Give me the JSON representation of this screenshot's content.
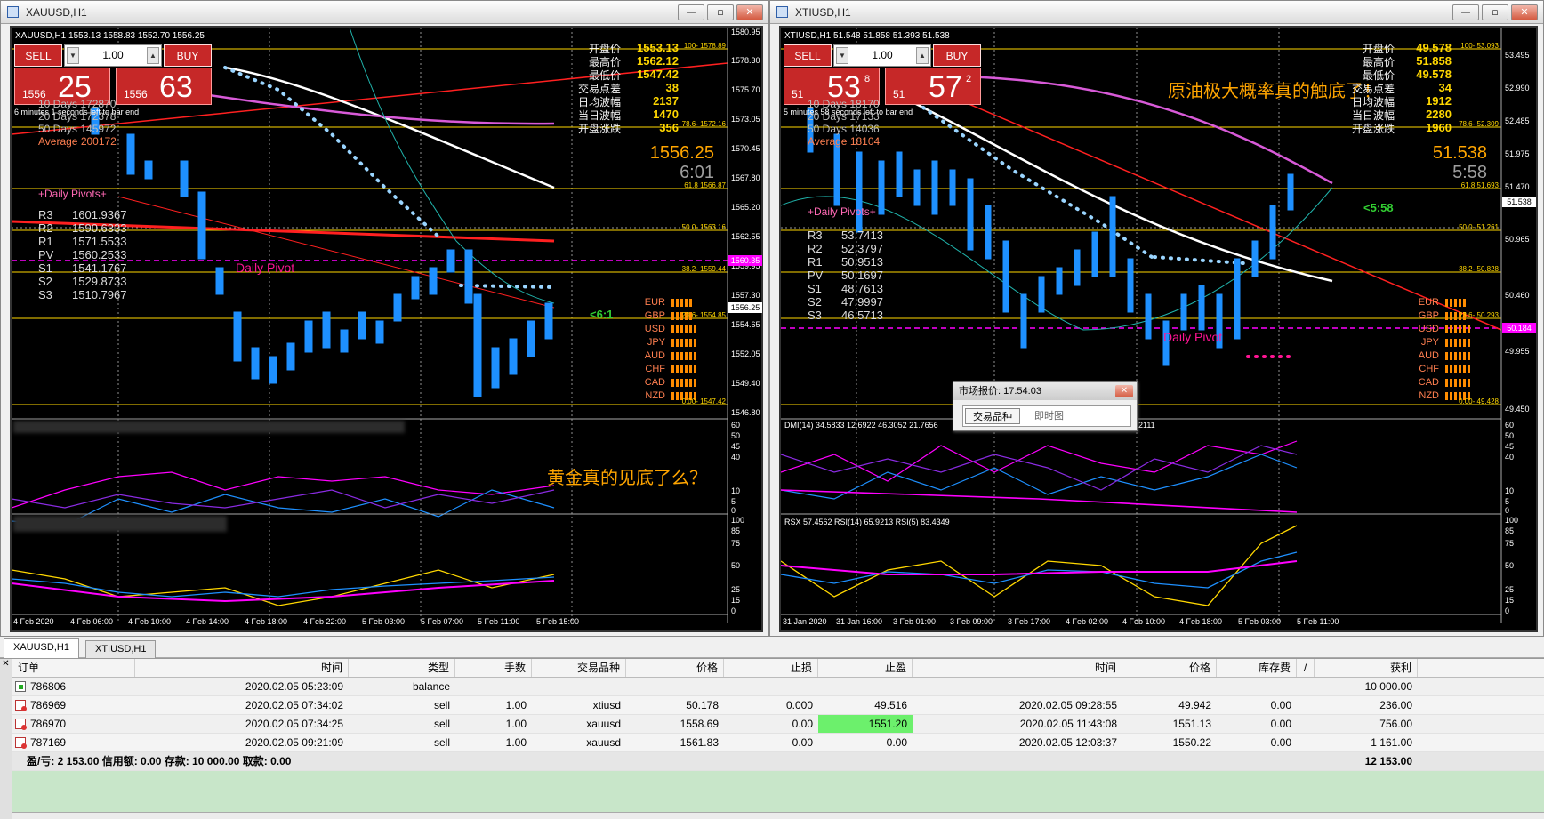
{
  "left_window": {
    "title": "XAUUSD,H1",
    "symbol_line": "XAUUSD,H1  1553.13 1558.83 1552.70 1556.25",
    "trade_panel": {
      "sell": "SELL",
      "buy": "BUY",
      "lot": "1.00",
      "bid_small": "1556",
      "bid_big": "25",
      "bid_sup": "",
      "ask_small": "1556",
      "ask_big": "63",
      "ask_sup": ""
    },
    "time_left": "6 minutes 1 seconds left to bar end",
    "ma_rows": [
      "10 Days  172870",
      "20 Days  172378",
      "50 Days  145972",
      "Average  200172"
    ],
    "pivots_title": "+Daily Pivots+",
    "pivots": [
      {
        "label": "R3",
        "value": "1601.9367"
      },
      {
        "label": "R2",
        "value": "1590.6333"
      },
      {
        "label": "R1",
        "value": "1571.5533"
      },
      {
        "label": "PV",
        "value": "1560.2533"
      },
      {
        "label": "S1",
        "value": "1541.1767"
      },
      {
        "label": "S2",
        "value": "1529.8733"
      },
      {
        "label": "S3",
        "value": "1510.7967"
      }
    ],
    "daily_pivot_label": "Daily Pivot",
    "info": [
      {
        "label": "开盘价",
        "value": "1553.13"
      },
      {
        "label": "最高价",
        "value": "1562.12"
      },
      {
        "label": "最低价",
        "value": "1547.42"
      },
      {
        "label": "交易点差",
        "value": "38"
      },
      {
        "label": "日均波幅",
        "value": "2137"
      },
      {
        "label": "当日波幅",
        "value": "1470"
      },
      {
        "label": "开盘涨跌",
        "value": "356"
      }
    ],
    "big_price": "1556.25",
    "big_time": "6:01",
    "ratio": "<6:1",
    "currencies": [
      "EUR",
      "GBP",
      "USD",
      "JPY",
      "AUD",
      "CHF",
      "CAD",
      "NZD"
    ],
    "fib_labels": [
      "100- 1578.89",
      "78.6- 1572.16",
      "61.8 1566.87",
      "50.0- 1563.16",
      "38.2- 1559.44",
      "23.6- 1554.85",
      "0.00- 1547.42"
    ],
    "price_axis": [
      "1580.95",
      "1578.30",
      "1575.70",
      "1573.05",
      "1570.45",
      "1567.80",
      "1565.20",
      "1562.55",
      "1559.95",
      "1557.30",
      "1554.65",
      "1552.05",
      "1549.40",
      "1546.80"
    ],
    "price_tag_magenta": "1560.35",
    "price_tag_white": "1556.25",
    "annotation": "黄金真的见底了么？",
    "dmi_levels": [
      "60",
      "50",
      "45",
      "40",
      "10",
      "5",
      "0"
    ],
    "rsi_levels": [
      "100",
      "85",
      "75",
      "50",
      "25",
      "15",
      "0"
    ],
    "time_axis": [
      "4 Feb 2020",
      "4 Feb 06:00",
      "4 Feb 10:00",
      "4 Feb 14:00",
      "4 Feb 18:00",
      "4 Feb 22:00",
      "5 Feb 03:00",
      "5 Feb 07:00",
      "5 Feb 11:00",
      "5 Feb 15:00"
    ]
  },
  "right_window": {
    "title": "XTIUSD,H1",
    "symbol_line": "XTIUSD,H1  51.548 51.858 51.393 51.538",
    "trade_panel": {
      "sell": "SELL",
      "buy": "BUY",
      "lot": "1.00",
      "bid_small": "51",
      "bid_big": "53",
      "bid_sup": "8",
      "ask_small": "51",
      "ask_big": "57",
      "ask_sup": "2"
    },
    "time_left": "5 minutes 58 seconds left to bar end",
    "ma_rows": [
      "10 Days  18170",
      "20 Days  17133",
      "50 Days  14036",
      "Average  18104"
    ],
    "pivots_title": "+Daily Pivots+",
    "pivots": [
      {
        "label": "R3",
        "value": "53.7413"
      },
      {
        "label": "R2",
        "value": "52.3797"
      },
      {
        "label": "R1",
        "value": "50.9513"
      },
      {
        "label": "PV",
        "value": "50.1697"
      },
      {
        "label": "S1",
        "value": "48.7613"
      },
      {
        "label": "S2",
        "value": "47.9997"
      },
      {
        "label": "S3",
        "value": "46.5713"
      }
    ],
    "daily_pivot_label": "Daily Pivot",
    "info": [
      {
        "label": "开盘价",
        "value": "49.578"
      },
      {
        "label": "最高价",
        "value": "51.858"
      },
      {
        "label": "最低价",
        "value": "49.578"
      },
      {
        "label": "交易点差",
        "value": "34"
      },
      {
        "label": "日均波幅",
        "value": "1912"
      },
      {
        "label": "当日波幅",
        "value": "2280"
      },
      {
        "label": "开盘涨跌",
        "value": "1960"
      }
    ],
    "big_price": "51.538",
    "big_time": "5:58",
    "ratio": "<5:58",
    "currencies": [
      "EUR",
      "GBP",
      "USD",
      "JPY",
      "AUD",
      "CHF",
      "CAD",
      "NZD"
    ],
    "fib_labels": [
      "100- 53.093",
      "78.6- 52.309",
      "61.8 51.693",
      "50.0- 51.261",
      "38.2- 50.828",
      "23.6- 50.293",
      "0.00- 49.428"
    ],
    "price_axis": [
      "53.495",
      "52.990",
      "52.485",
      "51.975",
      "51.470",
      "50.965",
      "50.460",
      "49.955",
      "49.450"
    ],
    "price_tag_magenta": "50.184",
    "price_tag_white": "51.538",
    "annotation": "原油极大概率真的触底了！",
    "dmi_line": "DMI(14) 34.5833 12.6922 46.3052 21.7656",
    "dmi_tail": "2111",
    "rsi_line": "RSX 57.4562  RSI(14) 65.9213  RSI(5) 83.4349",
    "dmi_levels": [
      "60",
      "50",
      "45",
      "40",
      "10",
      "5",
      "0"
    ],
    "rsi_levels": [
      "100",
      "85",
      "75",
      "50",
      "25",
      "15",
      "0"
    ],
    "time_axis": [
      "31 Jan 2020",
      "31 Jan 16:00",
      "3 Feb 01:00",
      "3 Feb 09:00",
      "3 Feb 17:00",
      "4 Feb 02:00",
      "4 Feb 10:00",
      "4 Feb 18:00",
      "5 Feb 03:00",
      "5 Feb 11:00"
    ]
  },
  "quote_popup": {
    "title": "市场报价: 17:54:03",
    "tab_active": "交易品种",
    "tab_inactive": "即时图"
  },
  "chart_tabs": [
    "XAUUSD,H1",
    "XTIUSD,H1"
  ],
  "terminal": {
    "headers": [
      "订单",
      "时间",
      "类型",
      "手数",
      "交易品种",
      "价格",
      "止损",
      "止盈",
      "时间",
      "价格",
      "库存费",
      "/",
      "获利"
    ],
    "rows": [
      {
        "order": "786806",
        "time": "2020.02.05 05:23:09",
        "type": "balance",
        "lots": "",
        "symbol": "",
        "price": "",
        "sl": "",
        "tp": "",
        "close_time": "",
        "close_price": "",
        "swap": "",
        "profit": "10 000.00",
        "icon": "bal"
      },
      {
        "order": "786969",
        "time": "2020.02.05 07:34:02",
        "type": "sell",
        "lots": "1.00",
        "symbol": "xtiusd",
        "price": "50.178",
        "sl": "0.000",
        "tp": "49.516",
        "close_time": "2020.02.05 09:28:55",
        "close_price": "49.942",
        "swap": "0.00",
        "profit": "236.00",
        "icon": "sell"
      },
      {
        "order": "786970",
        "time": "2020.02.05 07:34:25",
        "type": "sell",
        "lots": "1.00",
        "symbol": "xauusd",
        "price": "1558.69",
        "sl": "0.00",
        "tp": "1551.20",
        "close_time": "2020.02.05 11:43:08",
        "close_price": "1551.13",
        "swap": "0.00",
        "profit": "756.00",
        "icon": "sell",
        "tp_highlight": true
      },
      {
        "order": "787169",
        "time": "2020.02.05 09:21:09",
        "type": "sell",
        "lots": "1.00",
        "symbol": "xauusd",
        "price": "1561.83",
        "sl": "0.00",
        "tp": "0.00",
        "close_time": "2020.02.05 12:03:37",
        "close_price": "1550.22",
        "swap": "0.00",
        "profit": "1 161.00",
        "icon": "sell"
      }
    ],
    "summary": "盈/亏: 2 153.00  信用额: 0.00  存款: 10 000.00  取款: 0.00",
    "summary_total": "12 153.00"
  },
  "colors": {
    "sell_red": "#c62828",
    "chart_bg": "#000000",
    "candle_blue": "#1e90ff",
    "fib_yellow": "#ffd700",
    "pivot_magenta": "#ff00ff",
    "ma_white": "#ffffff",
    "profit_highlight": "#6cf06c"
  }
}
